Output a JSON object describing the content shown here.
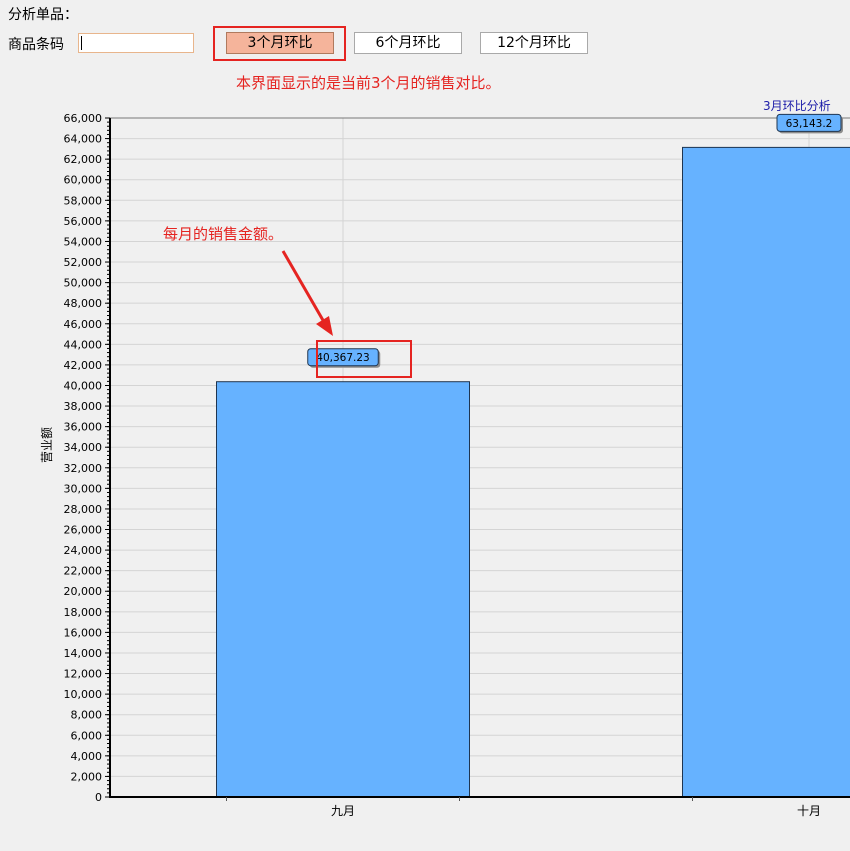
{
  "form": {
    "section_title": "分析单品：",
    "barcode_label": "商品条码",
    "barcode_value": "",
    "barcode_placeholder": ""
  },
  "buttons": {
    "three_month": "3个月环比",
    "six_month": "6个月环比",
    "twelve_month": "12个月环比",
    "active": "three_month"
  },
  "annotations": {
    "screen_note": "本界面显示的是当前3个月的销售对比。",
    "monthly_note": "每月的销售金额。"
  },
  "colors": {
    "bar_fill": "#66b2ff",
    "bar_stroke": "#1f3550",
    "annotation_red": "#e52421",
    "active_button": "#f5b49b",
    "chart_title": "#1a1aa8"
  },
  "chart_data": {
    "type": "bar",
    "title": "3月环比分析",
    "xlabel": "",
    "ylabel": "营业额",
    "categories": [
      "九月",
      "十月"
    ],
    "values": [
      40367.23,
      63143.2
    ],
    "value_labels": [
      "40,367.23",
      "63,143.2"
    ],
    "ylim": [
      0,
      66000
    ],
    "ytick_step": 2000,
    "grid": true,
    "legend": "none"
  }
}
